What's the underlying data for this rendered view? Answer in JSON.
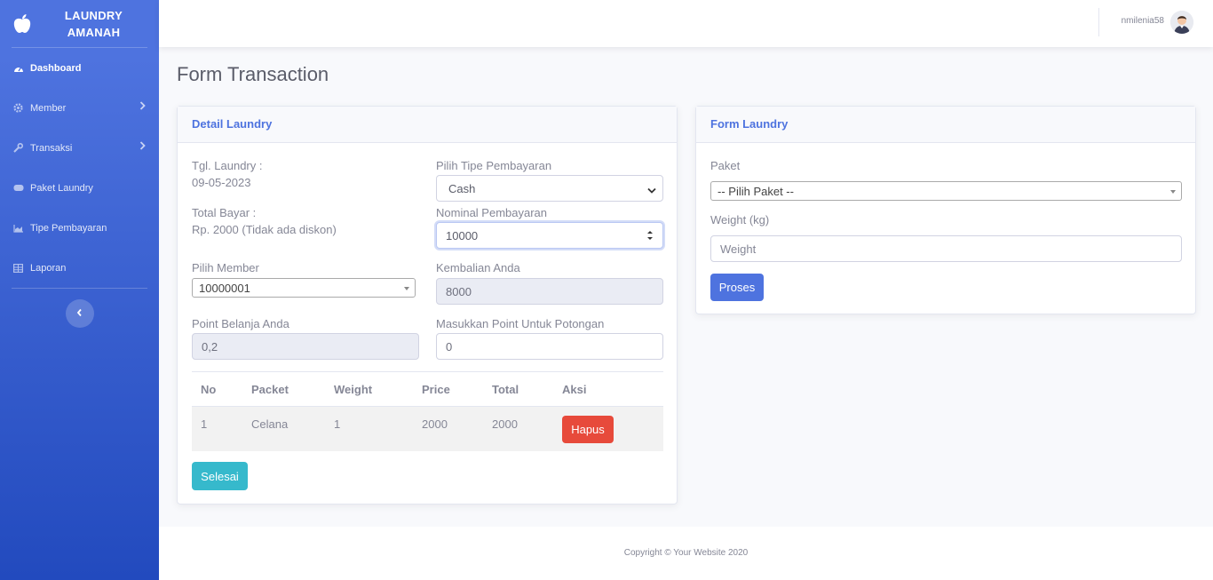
{
  "brand": {
    "line1": "LAUNDRY",
    "line2": "AMANAH",
    "logo_icon": "apple-icon"
  },
  "sidebar": {
    "items": [
      {
        "label": "Dashboard",
        "icon": "tachometer-icon",
        "active": true
      },
      {
        "label": "Member",
        "icon": "gear-icon",
        "has_children": true
      },
      {
        "label": "Transaksi",
        "icon": "wrench-icon",
        "has_children": true
      },
      {
        "label": "Paket Laundry",
        "icon": "gamepad-icon"
      },
      {
        "label": "Tipe Pembayaran",
        "icon": "chart-area-icon"
      },
      {
        "label": "Laporan",
        "icon": "table-icon"
      }
    ],
    "toggle_icon": "chevron-left-icon"
  },
  "topbar": {
    "username": "nmilenia58"
  },
  "page": {
    "title": "Form Transaction"
  },
  "detail": {
    "header": "Detail Laundry",
    "tgl_label": "Tgl. Laundry :",
    "tgl_value": "09-05-2023",
    "total_label": "Total Bayar :",
    "total_value": "Rp. 2000 (Tidak ada diskon)",
    "tipe_label": "Pilih Tipe Pembayaran",
    "tipe_value": "Cash",
    "nominal_label": "Nominal Pembayaran",
    "nominal_value": "10000",
    "member_label": "Pilih Member",
    "member_value": "10000001",
    "kembalian_label": "Kembalian Anda",
    "kembalian_value": "8000",
    "point_label": "Point Belanja Anda",
    "point_value": "0,2",
    "potongan_label": "Masukkan Point Untuk Potongan",
    "potongan_value": "0",
    "table": {
      "headers": [
        "No",
        "Packet",
        "Weight",
        "Price",
        "Total",
        "Aksi"
      ],
      "rows": [
        {
          "no": "1",
          "packet": "Celana",
          "weight": "1",
          "price": "2000",
          "total": "2000",
          "action": "Hapus"
        }
      ]
    },
    "finish_button": "Selesai"
  },
  "form_laundry": {
    "header": "Form Laundry",
    "paket_label": "Paket",
    "paket_value": "-- Pilih Paket --",
    "weight_label": "Weight (kg)",
    "weight_placeholder": "Weight",
    "submit_button": "Proses"
  },
  "footer": {
    "copyright": "Copyright © Your Website 2020"
  },
  "colors": {
    "primary": "#4e73df",
    "danger": "#e74a3b",
    "info": "#36b9cc"
  }
}
